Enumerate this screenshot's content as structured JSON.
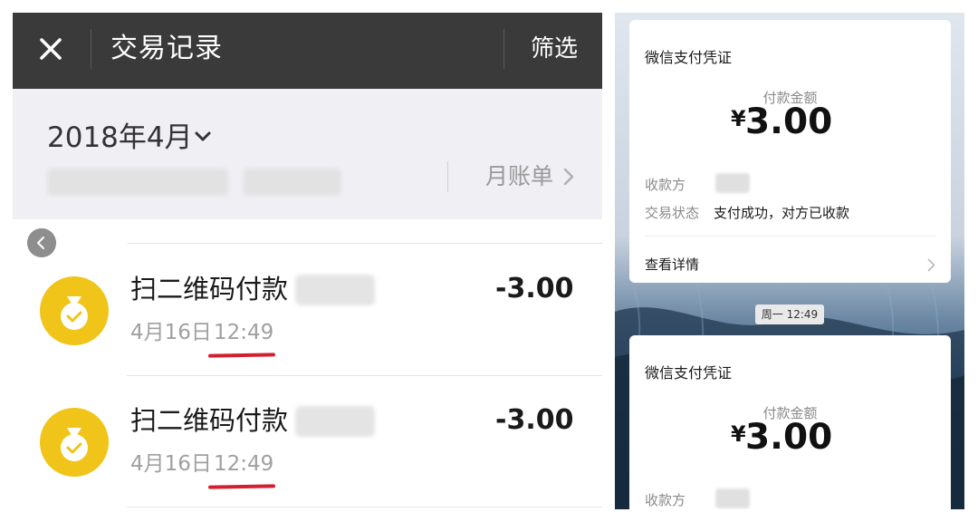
{
  "left": {
    "topbar": {
      "title": "交易记录",
      "filter_label": "筛选",
      "close_icon": "close-icon"
    },
    "month": {
      "label": "2018年4月",
      "monthly_bill_label": "月账单"
    },
    "transactions": [
      {
        "title": "扫二维码付款",
        "date": "4月16日",
        "time": "12:49",
        "amount": "-3.00",
        "icon": "money-bag-icon"
      },
      {
        "title": "扫二维码付款",
        "date": "4月16日",
        "time": "12:49",
        "amount": "-3.00",
        "icon": "money-bag-icon"
      }
    ],
    "colors": {
      "topbar": "#3a3a3a",
      "coin": "#f0c419",
      "underline": "#d32030"
    }
  },
  "right": {
    "cards": [
      {
        "title": "微信支付凭证",
        "amount_label": "付款金额",
        "currency": "¥",
        "amount": "3.00",
        "payee_label": "收款方",
        "status_label": "交易状态",
        "status_value": "支付成功，对方已收款",
        "detail_label": "查看详情"
      },
      {
        "title": "微信支付凭证",
        "amount_label": "付款金额",
        "currency": "¥",
        "amount": "3.00",
        "payee_label": "收款方"
      }
    ],
    "time_badge": "周一 12:49"
  }
}
